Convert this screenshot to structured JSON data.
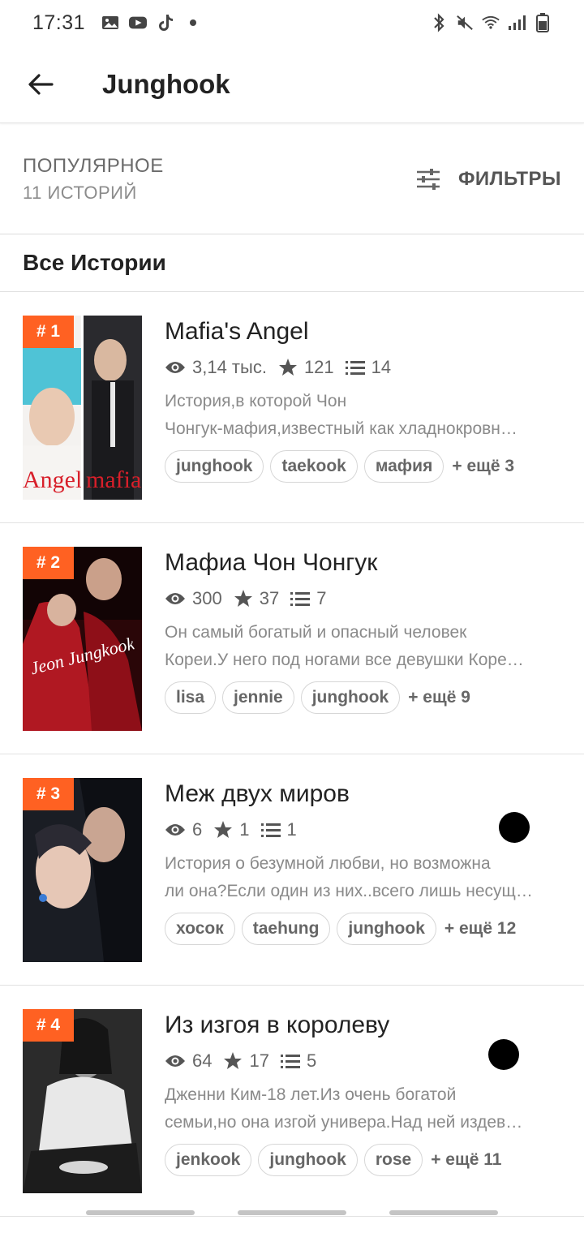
{
  "status": {
    "time": "17:31"
  },
  "header": {
    "title": "Junghook"
  },
  "filter_bar": {
    "popular_label": "ПОПУЛЯРНОЕ",
    "count_label": "11 ИСТОРИЙ",
    "filters_label": "ФИЛЬТРЫ"
  },
  "section": {
    "title": "Все Истории"
  },
  "stories": [
    {
      "rank": "# 1",
      "title": "Mafia's  Angel",
      "views": "3,14 тыс.",
      "votes": "121",
      "parts": "14",
      "desc_line1": "История,в которой Чон",
      "desc_line2": "Чонгук-мафия,известный как хладнокровн…",
      "tags": [
        "junghook",
        "taekook",
        "мафия"
      ],
      "more": "+ ещё 3",
      "cover_left_text": "Angel",
      "cover_right_text": "mafia"
    },
    {
      "rank": "# 2",
      "title": "Мафиа Чон Чонгук",
      "views": "300",
      "votes": "37",
      "parts": "7",
      "desc_line1": "Он самый богатый и опасный человек",
      "desc_line2": "Кореи.У него под ногами все девушки Коре…",
      "tags": [
        "lisa",
        "jennie",
        "junghook"
      ],
      "more": "+ ещё 9",
      "cover_text": "Jeon Jungkook"
    },
    {
      "rank": "# 3",
      "title": "Меж двух миров",
      "views": "6",
      "votes": "1",
      "parts": "1",
      "desc_line1": "История о безумной любви, но возможна",
      "desc_line2": "ли она?Если один из них..всего лишь несущ…",
      "tags": [
        "хосок",
        "taehung",
        "junghook"
      ],
      "more": "+ ещё 12"
    },
    {
      "rank": "# 4",
      "title": "Из изгоя в королеву",
      "views": "64",
      "votes": "17",
      "parts": "5",
      "desc_line1": "Дженни Ким-18 лет.Из очень богатой",
      "desc_line2": "семьи,но она изгой универа.Над ней издев…",
      "tags": [
        "jenkook",
        "junghook",
        "rose"
      ],
      "more": "+ ещё 11"
    }
  ],
  "colors": {
    "accent": "#ff6122",
    "text": "#222222",
    "muted": "#8a8a8a"
  },
  "icons": [
    "back-arrow-icon",
    "filter-sliders-icon",
    "eye-icon",
    "star-icon",
    "list-icon",
    "bluetooth-icon",
    "mute-icon",
    "wifi-icon",
    "signal-icon",
    "battery-icon"
  ]
}
